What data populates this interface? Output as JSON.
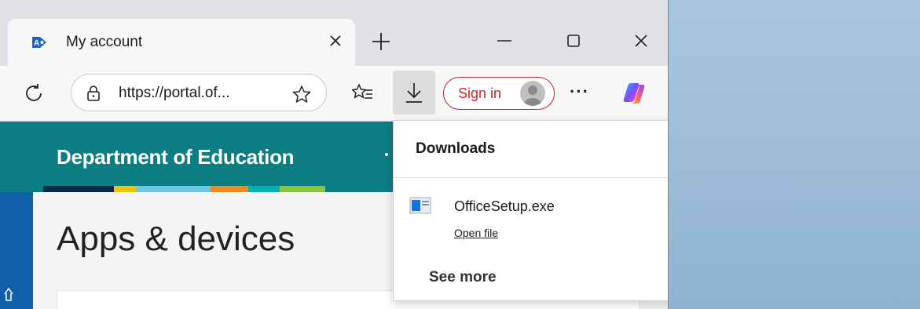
{
  "tab": {
    "title": "My account"
  },
  "address_bar": {
    "url": "https://portal.of..."
  },
  "toolbar": {
    "sign_in_label": "Sign in",
    "more_label": "···"
  },
  "page": {
    "org_title": "Department of Education",
    "heading": "Apps & devices"
  },
  "downloads": {
    "title": "Downloads",
    "more_label": "···",
    "items": [
      {
        "file_name": "OfficeSetup.exe",
        "action_label": "Open file"
      }
    ],
    "see_more_label": "See more"
  },
  "colors": {
    "header_teal": "#0d7d84",
    "nav_blue": "#0f5faa",
    "signin_red": "#c4262e",
    "colorbar": [
      "#0b2a4a",
      "#f2c300",
      "#6cc6e8",
      "#f28a1e",
      "#00b3b3",
      "#8cc43f"
    ]
  },
  "icons": {
    "favicon": "my-account-favicon-icon",
    "close": "close-icon",
    "new_tab": "plus-icon",
    "minimize": "minimize-icon",
    "maximize": "maximize-icon",
    "window_close": "window-close-icon",
    "refresh": "refresh-icon",
    "lock": "lock-icon",
    "favorite": "star-icon",
    "favorites_list": "favorites-list-icon",
    "download": "download-icon",
    "copilot": "copilot-icon",
    "folder": "folder-icon",
    "search": "search-icon",
    "pin": "pin-icon",
    "file": "file-icon"
  }
}
